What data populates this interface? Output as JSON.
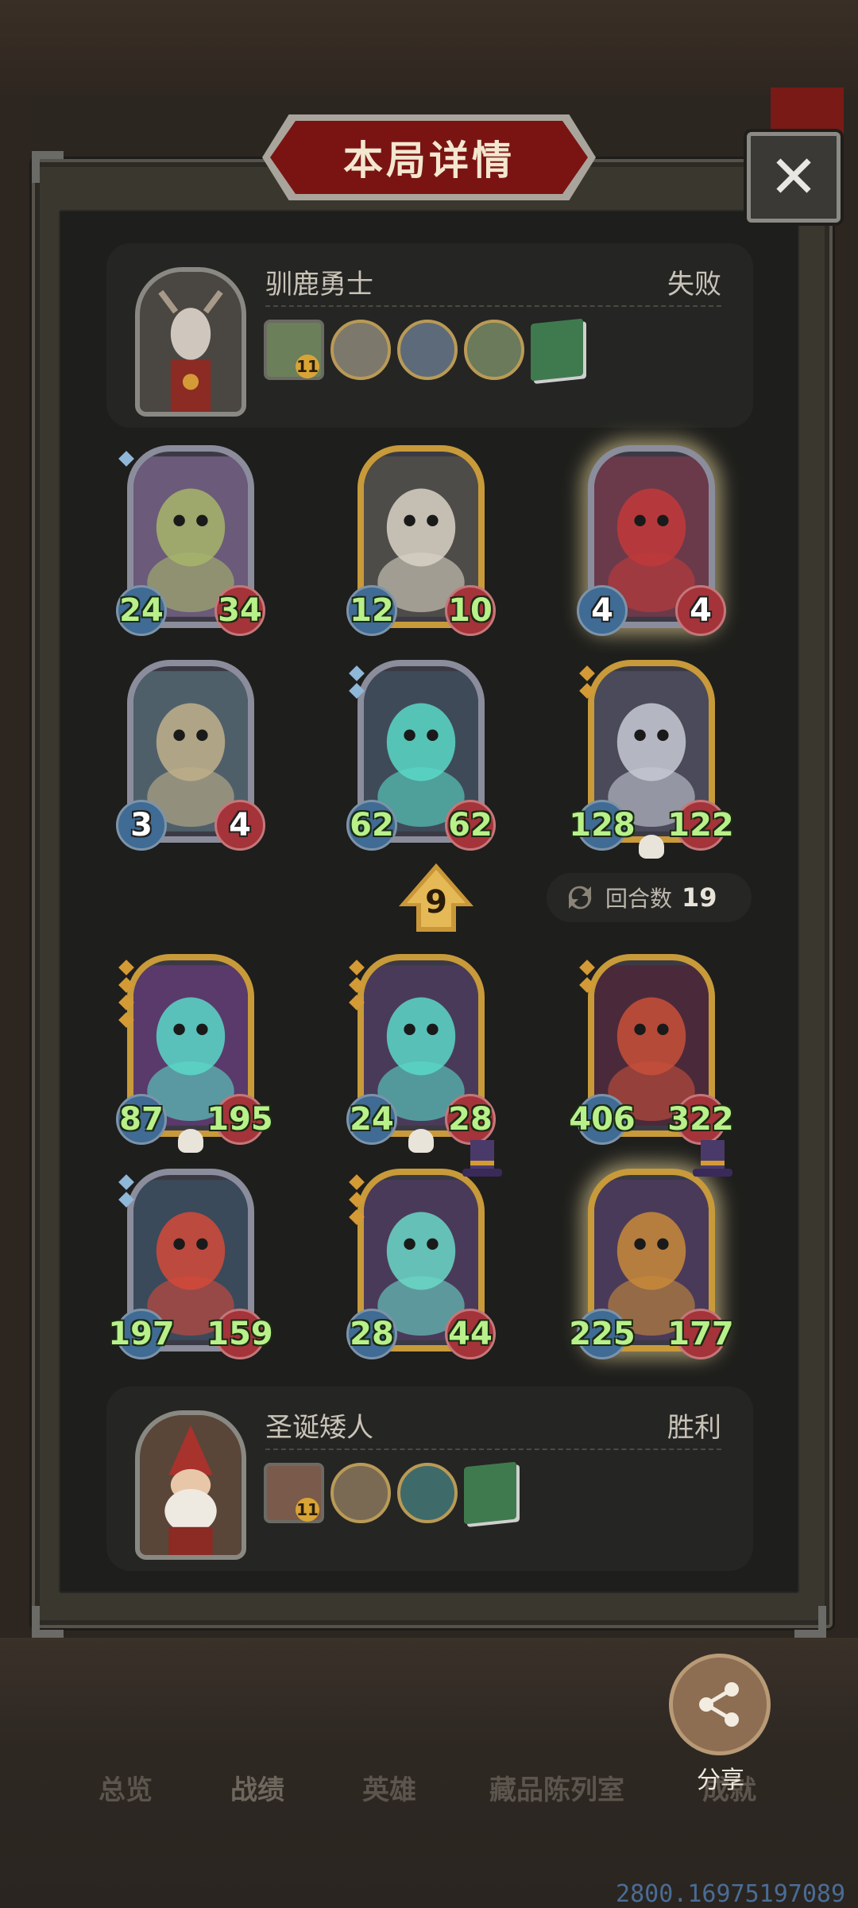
{
  "title": "本局详情",
  "close_label": "✕",
  "opponent": {
    "name": "驯鹿勇士",
    "result": "失败",
    "items": [
      "hero-card",
      "pocket-watch",
      "sword-medallion",
      "beast-medallion",
      "spell-book"
    ],
    "hero_level": "11"
  },
  "player": {
    "name": "圣诞矮人",
    "result": "胜利",
    "items": [
      "hero-card",
      "clockwork-medallion",
      "crystal-medallion",
      "spell-book"
    ],
    "hero_level": "11"
  },
  "opponent_units": [
    {
      "attack": "24",
      "health": "34",
      "frame": "silver",
      "creature": "purple-dragon"
    },
    {
      "attack": "12",
      "health": "10",
      "frame": "gold",
      "creature": "skull-reaper"
    },
    {
      "attack": "4",
      "health": "4",
      "frame": "silver",
      "creature": "clown-doll"
    },
    {
      "attack": "3",
      "health": "4",
      "frame": "silver",
      "creature": "horned-beast"
    },
    {
      "attack": "62",
      "health": "62",
      "frame": "silver",
      "creature": "ghost-giant"
    },
    {
      "attack": "128",
      "health": "122",
      "frame": "gold",
      "creature": "moon-rider"
    }
  ],
  "player_units": [
    {
      "attack": "87",
      "health": "195",
      "frame": "gold",
      "creature": "ghost-lady"
    },
    {
      "attack": "24",
      "health": "28",
      "frame": "gold",
      "creature": "ghost-king"
    },
    {
      "attack": "406",
      "health": "322",
      "frame": "gold",
      "creature": "fire-dragon"
    },
    {
      "attack": "197",
      "health": "159",
      "frame": "silver",
      "creature": "red-haired-maiden"
    },
    {
      "attack": "28",
      "health": "44",
      "frame": "gold",
      "creature": "ghost-soldier"
    },
    {
      "attack": "225",
      "health": "177",
      "frame": "gold",
      "creature": "pumpkin-golem"
    }
  ],
  "level_badge": "9",
  "rounds": {
    "label": "回合数",
    "value": "19"
  },
  "nav": {
    "overview": "总览",
    "record": "战绩",
    "heroes": "英雄",
    "gallery": "藏品陈列室",
    "achievements": "成就"
  },
  "share_label": "分享",
  "coords_readout": "2800.16975197089",
  "colors": {
    "panel_bg": "#1e1e1c",
    "attack_blue": "#3f6b94",
    "health_red": "#a4343a",
    "stat_green": "#b8f08a",
    "title_red": "#7a1412",
    "gold_frame": "#c89a3a"
  }
}
